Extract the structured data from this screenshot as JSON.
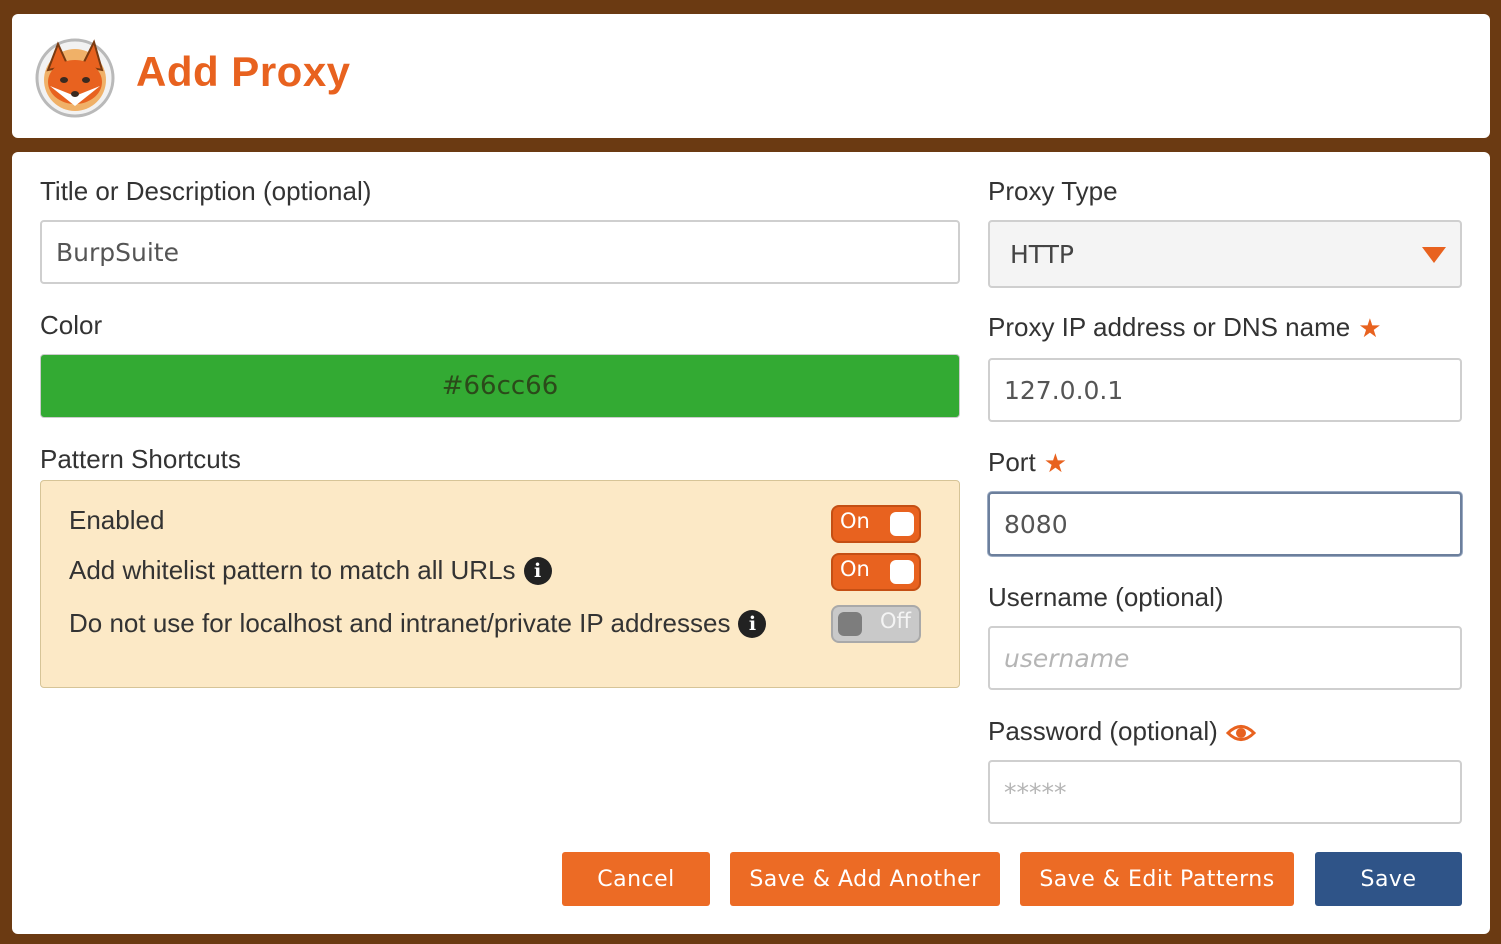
{
  "header": {
    "title": "Add Proxy"
  },
  "form": {
    "title_label": "Title or Description (optional)",
    "title_value": "BurpSuite",
    "color_label": "Color",
    "color_value": "#66cc66",
    "shortcuts_label": "Pattern Shortcuts",
    "shortcuts": [
      {
        "label": "Enabled",
        "state": "On",
        "info": false
      },
      {
        "label": "Add whitelist pattern to match all URLs",
        "state": "On",
        "info": true
      },
      {
        "label": "Do not use for localhost and intranet/private IP addresses",
        "state": "Off",
        "info": true
      }
    ],
    "proxy_type_label": "Proxy Type",
    "proxy_type_value": "HTTP",
    "ip_label": "Proxy IP address or DNS name",
    "ip_value": "127.0.0.1",
    "port_label": "Port",
    "port_value": "8080",
    "username_label": "Username (optional)",
    "username_placeholder": "username",
    "password_label": "Password (optional)",
    "password_placeholder": "*****"
  },
  "buttons": {
    "cancel": "Cancel",
    "save_add_another": "Save & Add Another",
    "save_edit_patterns": "Save & Edit Patterns",
    "save": "Save"
  },
  "colors": {
    "accent": "#e8621f",
    "primary_button": "#2f5488",
    "color_swatch": "#33aa33",
    "shortcuts_background": "#fce9c6",
    "frame": "#6b3a12"
  },
  "icons": [
    "fox-logo-icon",
    "info-icon",
    "star-icon",
    "eye-icon",
    "chevron-down-icon"
  ]
}
